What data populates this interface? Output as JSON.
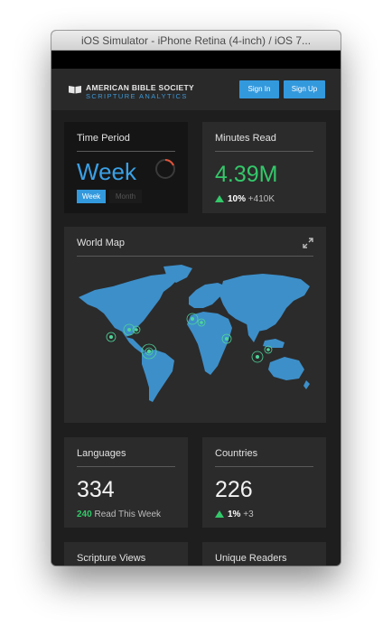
{
  "window": {
    "title": "iOS Simulator - iPhone Retina (4-inch) / iOS 7..."
  },
  "header": {
    "brand_line1": "AMERICAN BIBLE SOCIETY",
    "brand_line2": "SCRIPTURE ANALYTICS",
    "signin_label": "Sign In",
    "signup_label": "Sign Up"
  },
  "time_period": {
    "title": "Time Period",
    "value": "Week",
    "options": [
      "Week",
      "Month"
    ],
    "selected": "Week"
  },
  "minutes_read": {
    "title": "Minutes Read",
    "value": "4.39M",
    "change_percent": "10%",
    "change_abs": "+410K"
  },
  "world_map": {
    "title": "World Map"
  },
  "languages": {
    "title": "Languages",
    "value": "334",
    "read_count": "240",
    "read_label": "Read This Week"
  },
  "countries": {
    "title": "Countries",
    "value": "226",
    "change_percent": "1%",
    "change_abs": "+3"
  },
  "scripture_views": {
    "title": "Scripture Views"
  },
  "unique_readers": {
    "title": "Unique Readers"
  },
  "colors": {
    "accent_blue": "#3399dd",
    "positive_green": "#34c86a",
    "map_land": "#3d8fc9",
    "background": "#1e1e1e",
    "card": "#2b2b2b"
  }
}
